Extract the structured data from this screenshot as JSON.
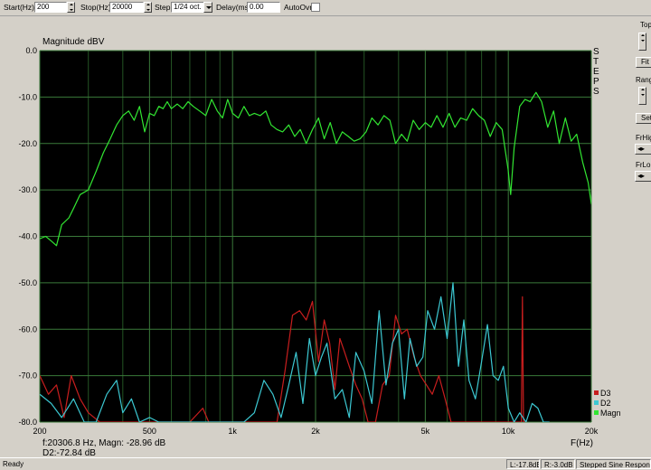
{
  "toolbar": {
    "start_label": "Start(Hz)",
    "start_value": "200",
    "stop_label": "Stop(Hz)",
    "stop_value": "20000",
    "step_label": "Step",
    "step_value": "1/24 oct.",
    "delay_label": "Delay(ms)",
    "delay_value": "0.00",
    "autoovr_label": "AutoOvr"
  },
  "right_panel": {
    "top_label": "Top",
    "fit_label": "Fit",
    "range_label": "Rang",
    "set_label": "Set",
    "frhigh_label": "FrHig",
    "frlow_label": "FrLo"
  },
  "status": {
    "ready": "Ready",
    "left_level": "L:-17.8dB",
    "right_level": "R:-3.0dB",
    "mode": "Stepped Sine Response"
  },
  "chart_data": {
    "type": "line",
    "title": "Magnitude dBV",
    "xlabel": "F(Hz)",
    "ylabel": "",
    "side_label": "STEPS",
    "xscale": "log",
    "xlim": [
      200,
      20000
    ],
    "ylim": [
      -80,
      0
    ],
    "y_ticks": [
      "0.0",
      "-10.0",
      "-20.0",
      "-30.0",
      "-40.0",
      "-50.0",
      "-60.0",
      "-70.0",
      "-80.0"
    ],
    "x_ticks": [
      {
        "v": 200,
        "label": "200"
      },
      {
        "v": 500,
        "label": "500"
      },
      {
        "v": 1000,
        "label": "1k"
      },
      {
        "v": 2000,
        "label": "2k"
      },
      {
        "v": 5000,
        "label": "5k"
      },
      {
        "v": 10000,
        "label": "10k"
      },
      {
        "v": 20000,
        "label": "20k"
      }
    ],
    "grid": true,
    "background": "#000000",
    "legend_position": "bottom-right",
    "readout_line1": "f:20306.8 Hz, Magn: -28.96 dB",
    "readout_line2": "D2:-72.84 dB",
    "series": [
      {
        "name": "Magn",
        "color": "#32e632",
        "points": [
          [
            200,
            -40.5
          ],
          [
            210,
            -40
          ],
          [
            220,
            -41
          ],
          [
            230,
            -42
          ],
          [
            240,
            -37.5
          ],
          [
            255,
            -36
          ],
          [
            265,
            -34
          ],
          [
            280,
            -31
          ],
          [
            300,
            -30
          ],
          [
            320,
            -26
          ],
          [
            340,
            -22
          ],
          [
            360,
            -19
          ],
          [
            380,
            -16
          ],
          [
            400,
            -14
          ],
          [
            420,
            -13
          ],
          [
            440,
            -15
          ],
          [
            460,
            -12
          ],
          [
            480,
            -17.5
          ],
          [
            500,
            -13.5
          ],
          [
            520,
            -14
          ],
          [
            540,
            -12
          ],
          [
            560,
            -12.5
          ],
          [
            580,
            -11
          ],
          [
            600,
            -12.5
          ],
          [
            630,
            -11.5
          ],
          [
            660,
            -12.5
          ],
          [
            690,
            -11
          ],
          [
            720,
            -12
          ],
          [
            760,
            -13
          ],
          [
            800,
            -14
          ],
          [
            840,
            -10.5
          ],
          [
            880,
            -13
          ],
          [
            920,
            -14.5
          ],
          [
            960,
            -10.5
          ],
          [
            1000,
            -13.5
          ],
          [
            1050,
            -14.5
          ],
          [
            1100,
            -12
          ],
          [
            1150,
            -14
          ],
          [
            1200,
            -13.5
          ],
          [
            1260,
            -14
          ],
          [
            1320,
            -13
          ],
          [
            1380,
            -16
          ],
          [
            1450,
            -17
          ],
          [
            1520,
            -17.5
          ],
          [
            1600,
            -16
          ],
          [
            1680,
            -18.5
          ],
          [
            1760,
            -17
          ],
          [
            1850,
            -20
          ],
          [
            1950,
            -17
          ],
          [
            2050,
            -14.5
          ],
          [
            2150,
            -19
          ],
          [
            2260,
            -15.5
          ],
          [
            2380,
            -20
          ],
          [
            2500,
            -17.5
          ],
          [
            2630,
            -18.5
          ],
          [
            2760,
            -19.5
          ],
          [
            2900,
            -19
          ],
          [
            3050,
            -17.5
          ],
          [
            3200,
            -14.5
          ],
          [
            3370,
            -16
          ],
          [
            3540,
            -14
          ],
          [
            3720,
            -15
          ],
          [
            3900,
            -20
          ],
          [
            4100,
            -18
          ],
          [
            4300,
            -19.5
          ],
          [
            4520,
            -15
          ],
          [
            4750,
            -17
          ],
          [
            5000,
            -15.5
          ],
          [
            5250,
            -16.5
          ],
          [
            5510,
            -14
          ],
          [
            5800,
            -16.5
          ],
          [
            6100,
            -13.5
          ],
          [
            6400,
            -16.5
          ],
          [
            6720,
            -14.5
          ],
          [
            7060,
            -15
          ],
          [
            7420,
            -12.5
          ],
          [
            7800,
            -14
          ],
          [
            8190,
            -15
          ],
          [
            8600,
            -18.5
          ],
          [
            9040,
            -15.5
          ],
          [
            9500,
            -17
          ],
          [
            9980,
            -25.5
          ],
          [
            10200,
            -31
          ],
          [
            10500,
            -21
          ],
          [
            11000,
            -12
          ],
          [
            11500,
            -10.5
          ],
          [
            12000,
            -11
          ],
          [
            12600,
            -9
          ],
          [
            13200,
            -11
          ],
          [
            13900,
            -16.5
          ],
          [
            14600,
            -13
          ],
          [
            15300,
            -20
          ],
          [
            16100,
            -14.5
          ],
          [
            16900,
            -19.5
          ],
          [
            17700,
            -18
          ],
          [
            18600,
            -24
          ],
          [
            19500,
            -28.5
          ],
          [
            20000,
            -33
          ],
          [
            20500,
            -30
          ],
          [
            21000,
            -29
          ]
        ]
      },
      {
        "name": "D2",
        "color": "#3cc8d2",
        "points": [
          [
            200,
            -74
          ],
          [
            220,
            -76
          ],
          [
            240,
            -79
          ],
          [
            265,
            -75
          ],
          [
            290,
            -80
          ],
          [
            320,
            -80
          ],
          [
            350,
            -74
          ],
          [
            380,
            -71
          ],
          [
            400,
            -78
          ],
          [
            430,
            -75
          ],
          [
            460,
            -80
          ],
          [
            500,
            -79
          ],
          [
            540,
            -80
          ],
          [
            580,
            -80
          ],
          [
            620,
            -80
          ],
          [
            680,
            -80
          ],
          [
            750,
            -80
          ],
          [
            820,
            -80
          ],
          [
            900,
            -80
          ],
          [
            1000,
            -80
          ],
          [
            1100,
            -80
          ],
          [
            1200,
            -78
          ],
          [
            1300,
            -71
          ],
          [
            1400,
            -74
          ],
          [
            1500,
            -79
          ],
          [
            1600,
            -72
          ],
          [
            1700,
            -65
          ],
          [
            1800,
            -76
          ],
          [
            1900,
            -62
          ],
          [
            2000,
            -70
          ],
          [
            2100,
            -66
          ],
          [
            2200,
            -63
          ],
          [
            2350,
            -75
          ],
          [
            2500,
            -73
          ],
          [
            2650,
            -79
          ],
          [
            2800,
            -65
          ],
          [
            3000,
            -69
          ],
          [
            3200,
            -76
          ],
          [
            3400,
            -56
          ],
          [
            3600,
            -72
          ],
          [
            3800,
            -63
          ],
          [
            4000,
            -60
          ],
          [
            4200,
            -75
          ],
          [
            4400,
            -62
          ],
          [
            4650,
            -68
          ],
          [
            4900,
            -66
          ],
          [
            5100,
            -56
          ],
          [
            5400,
            -60
          ],
          [
            5700,
            -53
          ],
          [
            6000,
            -62
          ],
          [
            6300,
            -50
          ],
          [
            6600,
            -68
          ],
          [
            6900,
            -58
          ],
          [
            7200,
            -71
          ],
          [
            7600,
            -75
          ],
          [
            8000,
            -67
          ],
          [
            8400,
            -59
          ],
          [
            8800,
            -70
          ],
          [
            9200,
            -71
          ],
          [
            9600,
            -68
          ],
          [
            10000,
            -77
          ],
          [
            10500,
            -80
          ],
          [
            11000,
            -78
          ],
          [
            11600,
            -80
          ],
          [
            12200,
            -76
          ],
          [
            12800,
            -77
          ],
          [
            13400,
            -80
          ],
          [
            14100,
            -80
          ]
        ]
      },
      {
        "name": "D3",
        "color": "#c81e1e",
        "points": [
          [
            200,
            -70
          ],
          [
            215,
            -74
          ],
          [
            230,
            -72
          ],
          [
            245,
            -79
          ],
          [
            260,
            -70
          ],
          [
            280,
            -75
          ],
          [
            300,
            -78
          ],
          [
            330,
            -80
          ],
          [
            360,
            -80
          ],
          [
            400,
            -80
          ],
          [
            450,
            -80
          ],
          [
            500,
            -80
          ],
          [
            600,
            -80
          ],
          [
            700,
            -80
          ],
          [
            780,
            -77
          ],
          [
            820,
            -80
          ],
          [
            900,
            -80
          ],
          [
            1000,
            -80
          ],
          [
            1100,
            -80
          ],
          [
            1200,
            -80
          ],
          [
            1300,
            -80
          ],
          [
            1450,
            -80
          ],
          [
            1550,
            -69
          ],
          [
            1650,
            -57
          ],
          [
            1750,
            -56
          ],
          [
            1850,
            -58
          ],
          [
            1950,
            -54
          ],
          [
            2050,
            -67
          ],
          [
            2150,
            -58
          ],
          [
            2250,
            -63
          ],
          [
            2350,
            -73
          ],
          [
            2450,
            -62
          ],
          [
            2550,
            -65
          ],
          [
            2650,
            -68
          ],
          [
            2800,
            -72
          ],
          [
            2950,
            -75
          ],
          [
            3100,
            -80
          ],
          [
            3300,
            -80
          ],
          [
            3500,
            -72
          ],
          [
            3700,
            -70
          ],
          [
            3900,
            -57
          ],
          [
            4100,
            -61
          ],
          [
            4300,
            -60
          ],
          [
            4550,
            -66
          ],
          [
            4800,
            -70
          ],
          [
            5050,
            -72
          ],
          [
            5300,
            -74
          ],
          [
            5600,
            -70
          ],
          [
            5900,
            -75
          ],
          [
            6200,
            -80
          ],
          [
            6600,
            -80
          ],
          [
            7000,
            -80
          ],
          [
            7500,
            -80
          ],
          [
            8000,
            -80
          ],
          [
            8600,
            -80
          ],
          [
            9200,
            -80
          ],
          [
            9800,
            -80
          ],
          [
            10400,
            -80
          ],
          [
            10800,
            -80
          ],
          [
            11150,
            -80
          ],
          [
            11250,
            -53
          ],
          [
            11350,
            -80
          ],
          [
            11700,
            -80
          ]
        ]
      }
    ]
  }
}
